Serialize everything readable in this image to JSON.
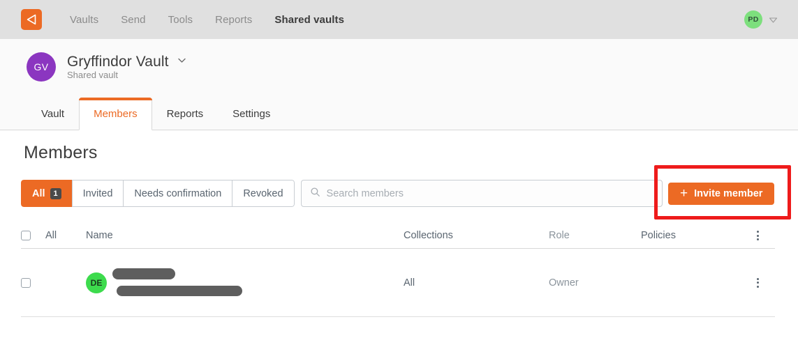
{
  "topnav": {
    "logo_icon": "bitwarden-shield-icon",
    "links": [
      {
        "label": "Vaults",
        "active": false
      },
      {
        "label": "Send",
        "active": false
      },
      {
        "label": "Tools",
        "active": false
      },
      {
        "label": "Reports",
        "active": false
      },
      {
        "label": "Shared vaults",
        "active": true
      }
    ],
    "account": {
      "avatar_initials": "PD",
      "avatar_color": "#7ddf7d",
      "chevron_icon": "chevron-down-icon"
    }
  },
  "vault_header": {
    "avatar_initials": "GV",
    "avatar_color": "#8b36c0",
    "title": "Gryffindor Vault",
    "subtitle": "Shared vault",
    "chevron_icon": "chevron-down-icon"
  },
  "tabs": [
    {
      "label": "Vault",
      "active": false
    },
    {
      "label": "Members",
      "active": true
    },
    {
      "label": "Reports",
      "active": false
    },
    {
      "label": "Settings",
      "active": false
    }
  ],
  "page": {
    "title": "Members",
    "accent_color": "#ec6a24",
    "annotation_color": "#ee1b1b"
  },
  "filters": [
    {
      "label": "All",
      "badge": "1",
      "active": true
    },
    {
      "label": "Invited",
      "badge": null,
      "active": false
    },
    {
      "label": "Needs confirmation",
      "badge": null,
      "active": false
    },
    {
      "label": "Revoked",
      "badge": null,
      "active": false
    }
  ],
  "search": {
    "placeholder": "Search members",
    "value": "",
    "icon": "search-icon"
  },
  "invite_button": {
    "label": "Invite member",
    "icon": "plus-icon"
  },
  "table": {
    "headers": {
      "select_all": "All",
      "name": "Name",
      "collections": "Collections",
      "role": "Role",
      "policies": "Policies",
      "menu_icon": "vertical-dots-icon"
    },
    "rows": [
      {
        "avatar_initials": "DE",
        "avatar_color": "#3ddb4d",
        "name": "",
        "email": "",
        "name_redacted": true,
        "email_redacted": true,
        "collections": "All",
        "role": "Owner",
        "policies": "",
        "menu_icon": "vertical-dots-icon"
      }
    ]
  }
}
